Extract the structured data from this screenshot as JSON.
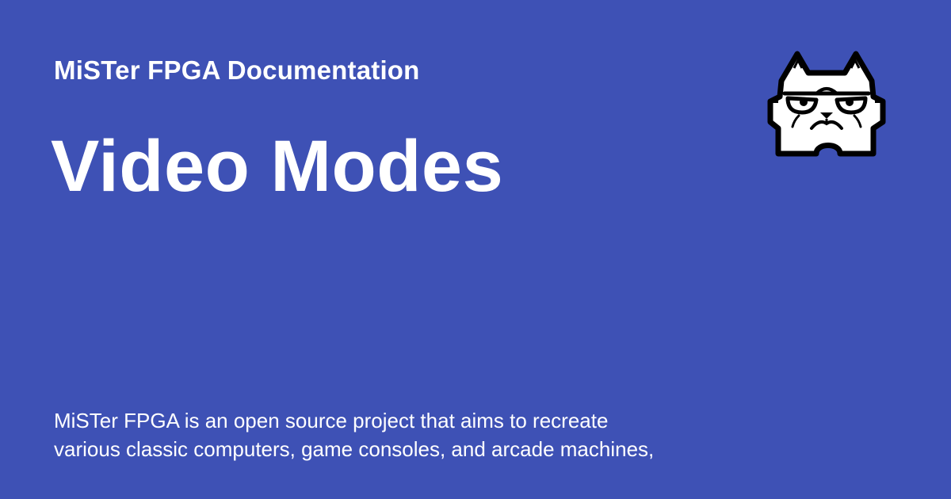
{
  "site": {
    "name": "MiSTer FPGA Documentation"
  },
  "page": {
    "title": "Video Modes"
  },
  "description": {
    "lines": [
      "MiSTer FPGA is an open source project that aims to recreate",
      "various classic computers, game consoles, and arcade machines,"
    ]
  },
  "logo": {
    "icon": "grumpy-cat-icon"
  },
  "colors": {
    "background": "#3e51b5",
    "text": "#ffffff",
    "logo_outline": "#000000",
    "logo_fill": "#ffffff"
  }
}
